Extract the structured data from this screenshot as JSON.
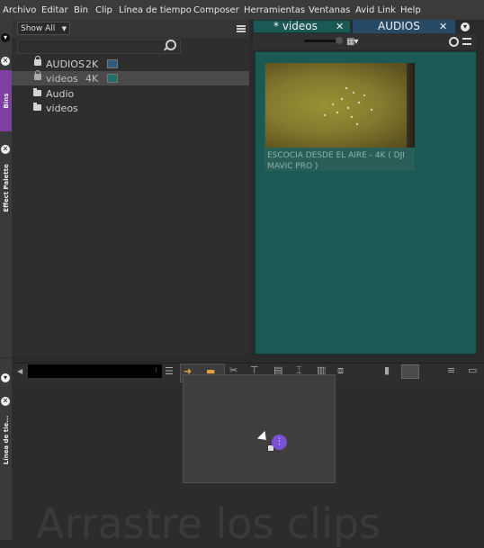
{
  "menu": [
    "Archivo",
    "Editar",
    "Bin",
    "Clip",
    "Línea de tiempo",
    "Composer",
    "Herramientas",
    "Ventanas",
    "Avid Link",
    "Help"
  ],
  "side_tabs": {
    "bins": "Bins",
    "effect_palette": "Effect Palette",
    "timeline": "Línea de tie..."
  },
  "bin_panel": {
    "filter": "Show All",
    "items": [
      {
        "name": "AUDIOS",
        "res": "2K",
        "swatch": "#2f5a7a",
        "icon": "lock-icon",
        "selected": false
      },
      {
        "name": "videos",
        "res": "4K",
        "swatch": "#1f6e6a",
        "icon": "lock-icon",
        "selected": true
      },
      {
        "name": "Audio",
        "res": "",
        "swatch": "",
        "icon": "folder-icon",
        "selected": false
      },
      {
        "name": "videos",
        "res": "",
        "swatch": "",
        "icon": "folder-icon",
        "selected": false
      }
    ]
  },
  "clip_panel": {
    "tabs": [
      {
        "label": "* videos",
        "active": true
      },
      {
        "label": "AUDIOS",
        "active": false
      }
    ],
    "clip_title": "ESCOCIA DESDE EL AIRE - 4K ( DJI MAVIC PRO )",
    "canvas_color": "#1b5a54"
  },
  "timeline": {
    "placeholder": "Arrastre los clips"
  },
  "colors": {
    "accent": "#7b4fd6",
    "tab_active": "#1b5a54",
    "bins_tab": "#7e3fa3"
  }
}
